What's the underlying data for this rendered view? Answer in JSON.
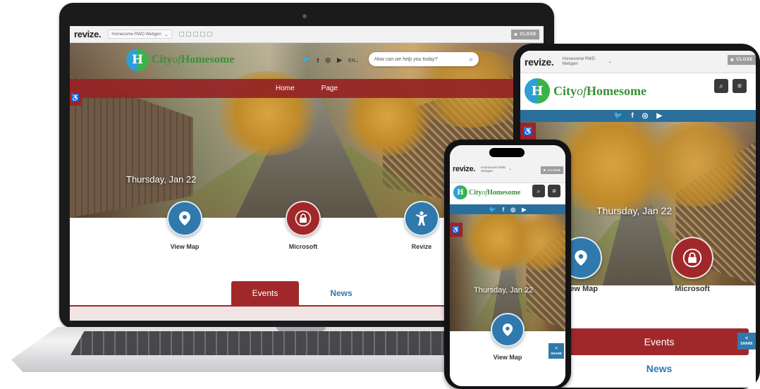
{
  "brand": {
    "admin_logo": "revize.",
    "site_selector": "Homesome RWD Webgen",
    "site_selector_short_1": "Homesome RWD",
    "site_selector_short_2": "Webgen",
    "close_label": "CLOSE",
    "close_icon": "✖",
    "logo_letter": "H",
    "logo_city": "City",
    "logo_of": "of",
    "logo_name": "Homesome"
  },
  "colors": {
    "primary_red": "#a1282a",
    "primary_blue": "#2f79ad",
    "logo_green": "#3b8f3a"
  },
  "nav": {
    "items": [
      "Home",
      "Page"
    ]
  },
  "header": {
    "language": "EN",
    "search_placeholder": "How can we help you today?"
  },
  "hero": {
    "date": "Thursday, Jan 22"
  },
  "quick_links": [
    {
      "label": "View Map",
      "icon": "map-pin-icon",
      "color": "#2f79ad"
    },
    {
      "label": "Microsoft",
      "icon": "lock-icon",
      "color": "#a1282a"
    },
    {
      "label": "Revize",
      "icon": "person-icon",
      "color": "#2f79ad"
    }
  ],
  "tabs": {
    "events": "Events",
    "news": "News"
  },
  "share": {
    "label": "SHARE"
  },
  "icons": {
    "social": [
      "twitter-icon",
      "facebook-icon",
      "instagram-icon",
      "youtube-icon"
    ],
    "accessibility": "wheelchair-icon",
    "search": "search-icon",
    "menu": "hamburger-menu-icon"
  }
}
